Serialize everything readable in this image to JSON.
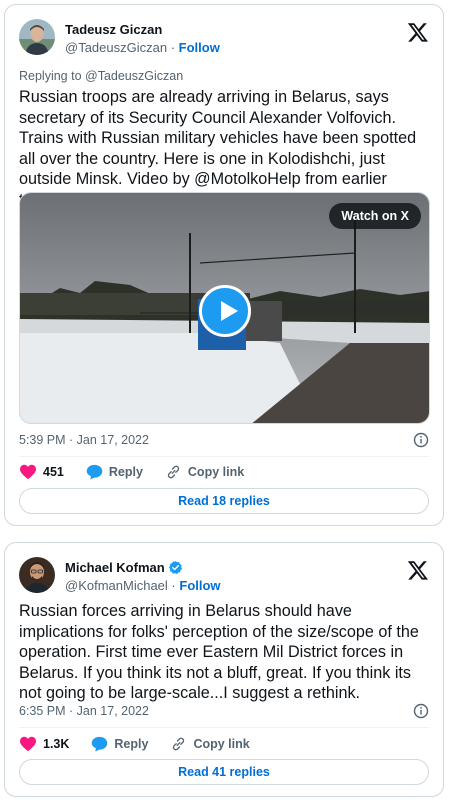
{
  "tweets": [
    {
      "author": {
        "name": "Tadeusz Giczan",
        "handle": "@TadeuszGiczan",
        "verified": false
      },
      "follow_label": "Follow",
      "separator": "·",
      "replying_to": "Replying to @TadeuszGiczan",
      "text": "Russian troops are already arriving in Belarus, says secretary of its Security Council Alexander Volfovich. Trains with Russian military vehicles have been spotted all over the country. Here is one in Kolodishchi, just outside Minsk. Video by @MotolkoHelp from earlier today.",
      "media": {
        "type": "video",
        "watch_label": "Watch on X"
      },
      "timestamp": "5:39 PM · Jan 17, 2022",
      "likes": "451",
      "reply_label": "Reply",
      "copy_label": "Copy link",
      "read_replies": "Read 18 replies"
    },
    {
      "author": {
        "name": "Michael Kofman",
        "handle": "@KofmanMichael",
        "verified": true
      },
      "follow_label": "Follow",
      "separator": "·",
      "text": "Russian forces arriving in Belarus should have implications for folks' perception of the size/scope of the operation. First time ever Eastern Mil District forces in Belarus. If you think its not a bluff, great. If you think its not going to be large-scale...I suggest a rethink.",
      "timestamp": "6:35 PM · Jan 17, 2022",
      "likes": "1.3K",
      "reply_label": "Reply",
      "copy_label": "Copy link",
      "read_replies": "Read 41 replies"
    }
  ],
  "colors": {
    "like": "#f91880",
    "reply": "#1d9bf0",
    "link": "#006fd6",
    "verified": "#1d9bf0",
    "play": "#1d9bf0"
  },
  "icons": [
    "x-logo-icon",
    "info-icon",
    "heart-icon",
    "reply-bubble-icon",
    "link-icon",
    "verified-badge-icon",
    "play-icon"
  ]
}
